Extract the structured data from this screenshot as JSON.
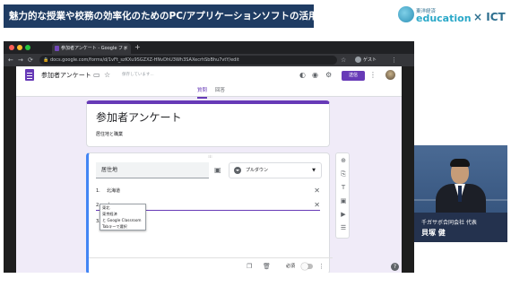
{
  "slide": {
    "title": "魅力的な授業や校務の効率化のためのPC/アプリケーションソフトの活用術",
    "brand": {
      "small": "東洋経済",
      "edu": "education",
      "sep": "×",
      "ict": "ICT"
    }
  },
  "browser": {
    "tab_title": "参加者アンケート - Google フォ",
    "tab_close": "×",
    "new_tab": "+",
    "back": "←",
    "forward": "→",
    "reload": "⟳",
    "lock": "🔒",
    "url": "docs.google.com/forms/d/1vFt_szKXu9SGZXZ-HNvDhU3Wh3SAXecrhSbBhu7vtY/edit",
    "star": "☆",
    "profile_label": "ゲスト",
    "menu": "⋮"
  },
  "forms": {
    "doc_title": "参加者アンケート",
    "folder_icon": "folder-icon",
    "saved_text": "保存しています...",
    "send_label": "送信",
    "tabs": [
      "質問",
      "回答"
    ],
    "form_title": "参加者アンケート",
    "form_description": "居住地と職業",
    "question": {
      "title": "居住地",
      "type_label": "プルダウン",
      "options": [
        {
          "num": "1.",
          "text": "北海道"
        },
        {
          "num": "2.",
          "text": "上"
        },
        {
          "num": "3.",
          "text": ""
        }
      ],
      "autocomplete": [
        "東北",
        "東京経済",
        "と Google Classroom",
        "Tabキーで選択"
      ],
      "required_label": "必須"
    }
  },
  "speaker": {
    "company": "千ガサボ合同会社 代表",
    "name": "貝塚 健"
  }
}
